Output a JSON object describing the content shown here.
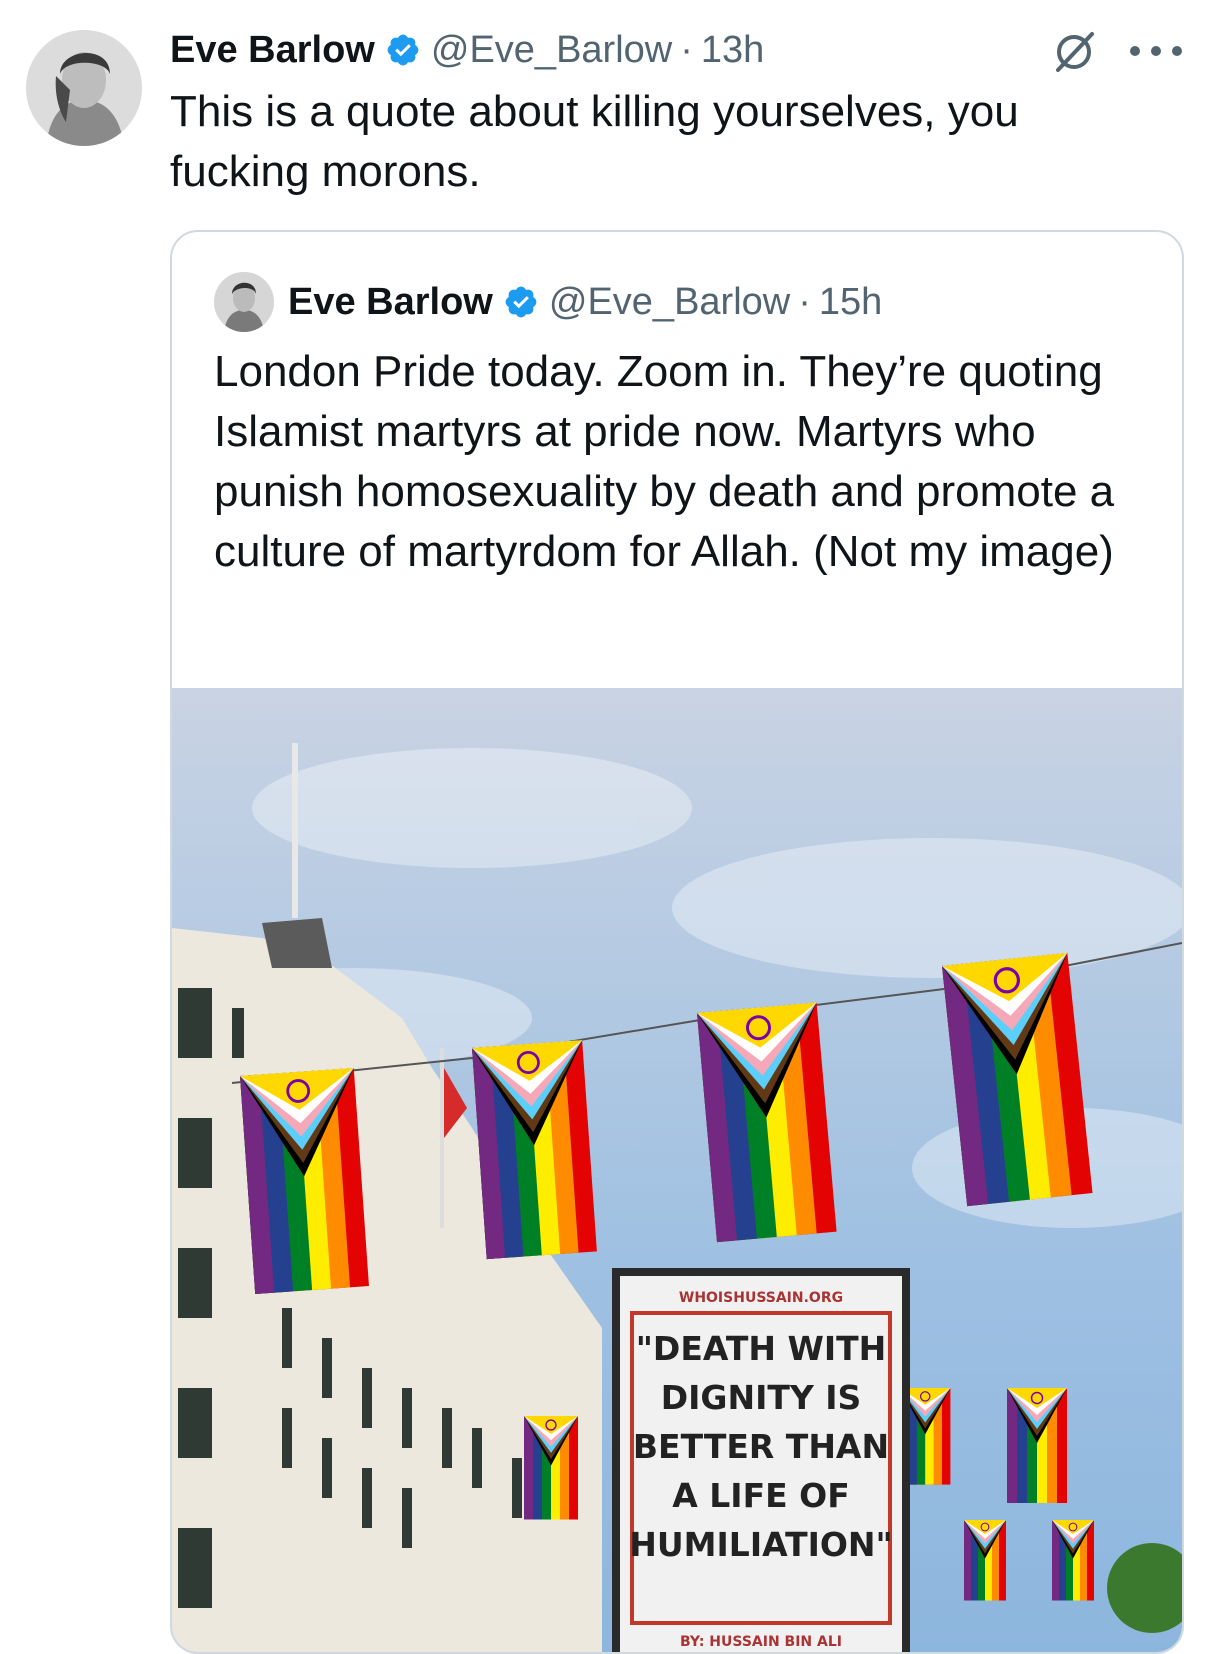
{
  "tweet": {
    "author_name": "Eve Barlow",
    "handle": "@Eve_Barlow",
    "separator": "·",
    "time": "13h",
    "text": "This is a quote about killing yourselves, you fucking morons.",
    "icons": {
      "verified": "verified-badge-icon",
      "grok": "grok-icon",
      "more": "more-options-icon"
    },
    "colors": {
      "verified": "#1d9bf0",
      "secondary_text": "#536471",
      "border": "#cfd9de"
    }
  },
  "quoted_tweet": {
    "author_name": "Eve Barlow",
    "handle": "@Eve_Barlow",
    "separator": "·",
    "time": "15h",
    "text": "London Pride today. Zoom in. They’re quoting Islamist martyrs at pride now. Martyrs who punish homosexuality by death and promote a culture of martyrdom for Allah. (Not my image)",
    "image": {
      "sign_header": "WHOISHUSSAIN.ORG",
      "sign_lines": [
        "\"DEATH WITH",
        "DIGNITY IS",
        "BETTER THAN",
        "A LIFE OF",
        "HUMILIATION\""
      ],
      "sign_footer": "BY: HUSSAIN BIN ALI"
    }
  }
}
